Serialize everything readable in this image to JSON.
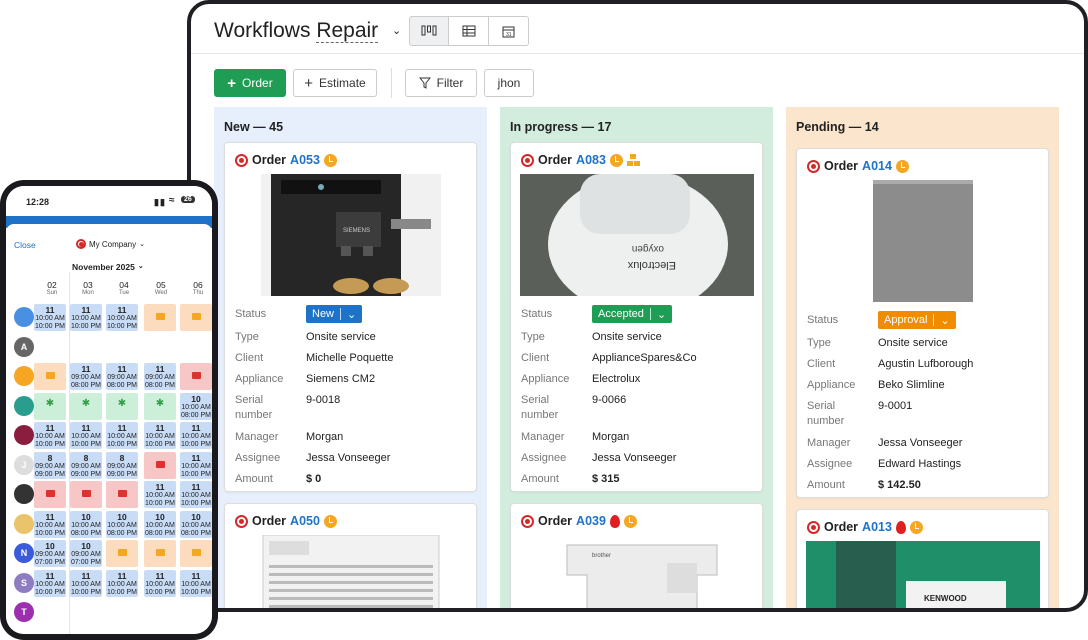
{
  "app": {
    "title_prefix": "Workflows",
    "title_board": "Repair",
    "views": [
      "board-view-icon",
      "table-view-icon",
      "calendar-view-icon"
    ],
    "toolbar": {
      "order_label": "Order",
      "estimate_label": "Estimate",
      "filter_label": "Filter",
      "user_filter": "jhon"
    },
    "colors": {
      "primary_green": "#1f9d55",
      "link_blue": "#1e73c9"
    }
  },
  "field_labels": {
    "status": "Status",
    "type": "Type",
    "client": "Client",
    "appliance": "Appliance",
    "serial_a": "Serial",
    "serial_b": "number",
    "manager": "Manager",
    "assignee": "Assignee",
    "amount": "Amount"
  },
  "columns": [
    {
      "header": "New — 45",
      "bg": "#e6effb",
      "cards": [
        {
          "order_word": "Order",
          "id": "A053",
          "status": "New",
          "status_color": "#1e73c9",
          "type": "Onsite service",
          "client": "Michelle Poquette",
          "appliance": "Siemens CM2",
          "serial": "9-0018",
          "manager": "Morgan",
          "assignee": "Jessa Vonseeger",
          "amount": "$ 0"
        },
        {
          "order_word": "Order",
          "id": "A050"
        }
      ]
    },
    {
      "header": "In progress — 17",
      "bg": "#d2ecde",
      "cards": [
        {
          "order_word": "Order",
          "id": "A083",
          "status": "Accepted",
          "status_color": "#1f9d55",
          "type": "Onsite service",
          "client": "ApplianceSpares&Co",
          "appliance": "Electrolux",
          "serial": "9-0066",
          "manager": "Morgan",
          "assignee": "Jessa Vonseeger",
          "amount": "$ 315"
        },
        {
          "order_word": "Order",
          "id": "A039"
        }
      ]
    },
    {
      "header": "Pending — 14",
      "bg": "#fbe5cc",
      "cards": [
        {
          "order_word": "Order",
          "id": "A014",
          "status": "Approval",
          "status_color": "#f08c00",
          "type": "Onsite service",
          "client": "Agustin Lufborough",
          "appliance": "Beko Slimline",
          "serial": "9-0001",
          "manager": "Jessa Vonseeger",
          "assignee": "Edward Hastings",
          "amount": "$ 142.50"
        },
        {
          "order_word": "Order",
          "id": "A013"
        }
      ]
    }
  ],
  "product_text": {
    "siemens": "SIEMENS",
    "electrolux": "Electrolux",
    "oxygen": "oxygen",
    "brother": "brother",
    "kenwood": "KENWOOD"
  },
  "phone": {
    "time": "12:28",
    "battery": "26",
    "close_label": "Close",
    "company": "My Company",
    "month": "November 2025",
    "days": [
      {
        "num": "02",
        "name": "Sun"
      },
      {
        "num": "03",
        "name": "Mon"
      },
      {
        "num": "04",
        "name": "Tue"
      },
      {
        "num": "05",
        "name": "Wed"
      },
      {
        "num": "06",
        "name": "Thu"
      }
    ],
    "avatars": [
      "",
      "A",
      "",
      "",
      "",
      "J",
      "",
      "",
      "N",
      "S",
      "T"
    ],
    "t11": "11",
    "t10": "10",
    "t8": "8",
    "am10": "10:00 AM",
    "pm10": "10:00 PM",
    "am9": "09:00 AM",
    "pm8": "08:00 PM",
    "pm9": "09:00 PM",
    "pm7": "07:00 PM"
  }
}
